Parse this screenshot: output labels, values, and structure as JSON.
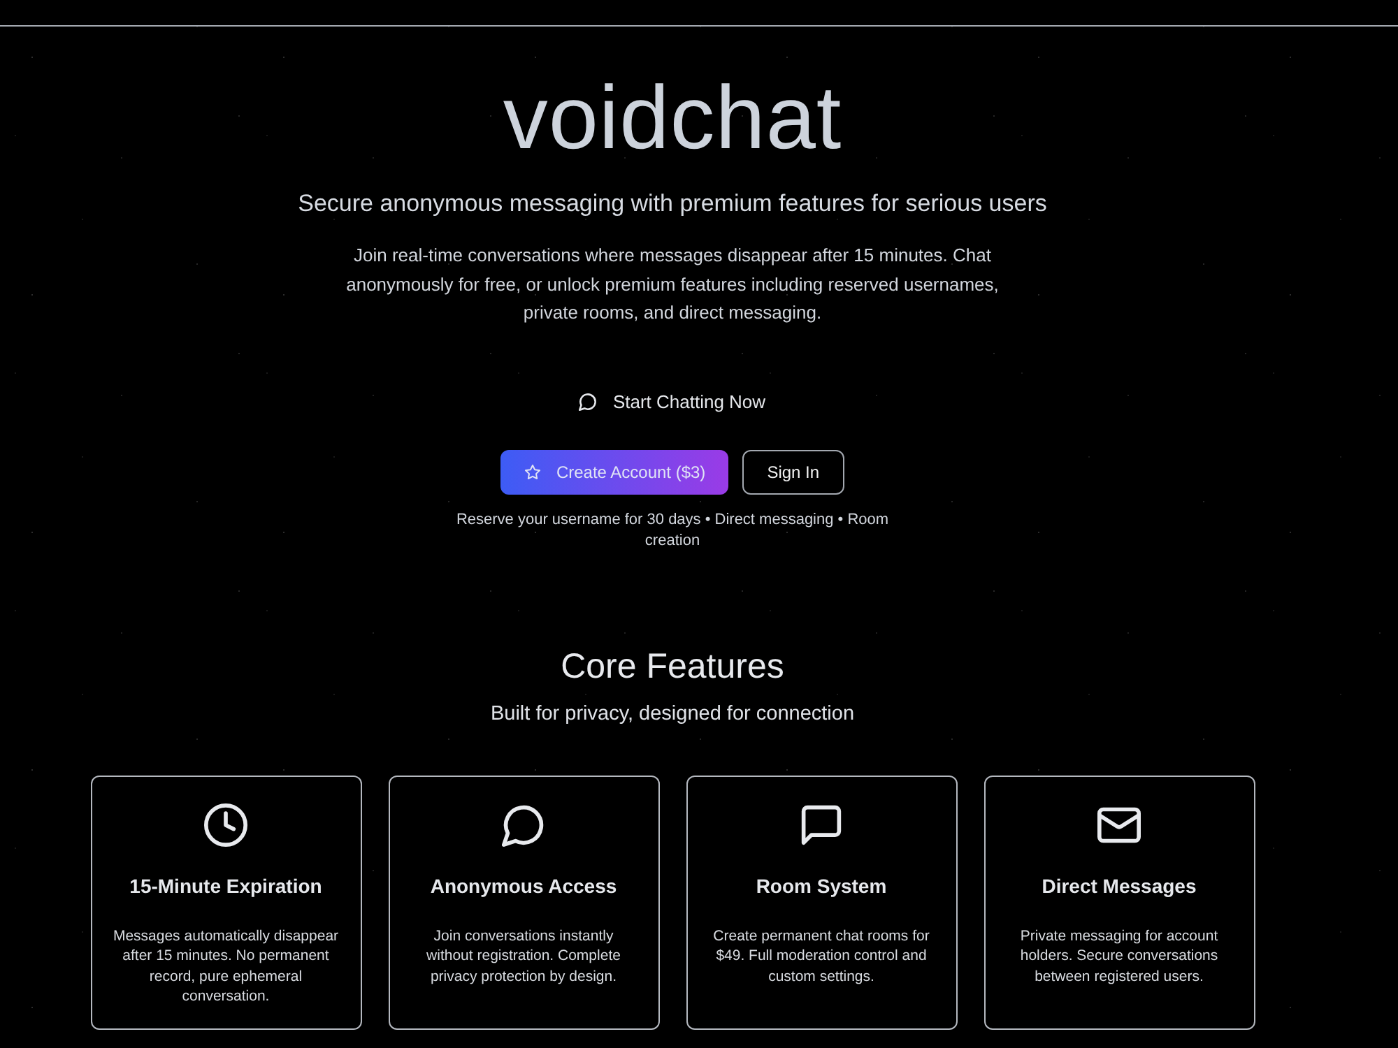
{
  "brand": {
    "name": "voidchat"
  },
  "hero": {
    "tagline": "Secure anonymous messaging with premium features for serious users",
    "description": "Join real-time conversations where messages disappear after 15 minutes. Chat anonymously for free, or unlock premium features including reserved usernames, private rooms, and direct messaging.",
    "start_button": {
      "label": "Start Chatting Now"
    },
    "buttons": [
      {
        "kind": "primary",
        "label": "Create Account ($3)"
      },
      {
        "kind": "outline",
        "label": "Sign In"
      }
    ],
    "note": "Reserve your username for 30 days • Direct messaging • Room creation"
  },
  "features": {
    "title": "Core Features",
    "subtitle": "Built for privacy, designed for connection",
    "cards": [
      {
        "title": "15-Minute Expiration",
        "description": "Messages automatically disappear after 15 minutes. No permanent record, pure ephemeral conversation."
      },
      {
        "title": "Anonymous Access",
        "description": "Join conversations instantly without registration. Complete privacy protection by design."
      },
      {
        "title": "Room System",
        "description": "Create permanent chat rooms for $49. Full moderation control and custom settings."
      },
      {
        "title": "Direct Messages",
        "description": "Private messaging for account holders. Secure conversations between registered users."
      }
    ]
  }
}
